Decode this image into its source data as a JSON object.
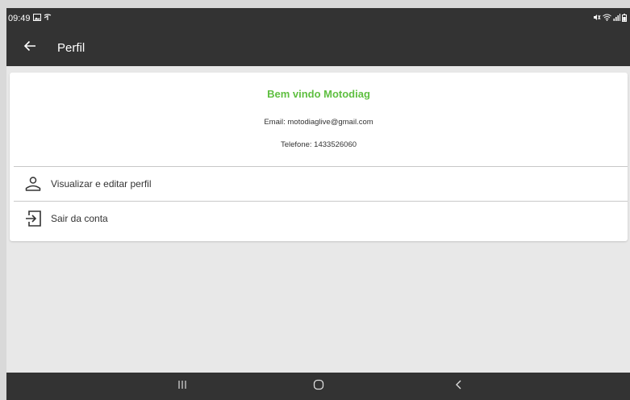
{
  "status_bar": {
    "time": "09:49"
  },
  "app_bar": {
    "title": "Perfil"
  },
  "profile": {
    "welcome": "Bem vindo Motodiag",
    "email": "Email: motodiaglive@gmail.com",
    "phone": "Telefone: 1433526060"
  },
  "menu": {
    "items": [
      {
        "label": "Visualizar e editar perfil",
        "icon": "person-icon"
      },
      {
        "label": "Sair da conta",
        "icon": "logout-icon"
      }
    ]
  },
  "colors": {
    "accent": "#5fbf41",
    "bar": "#333333",
    "background": "#e8e8e8"
  }
}
